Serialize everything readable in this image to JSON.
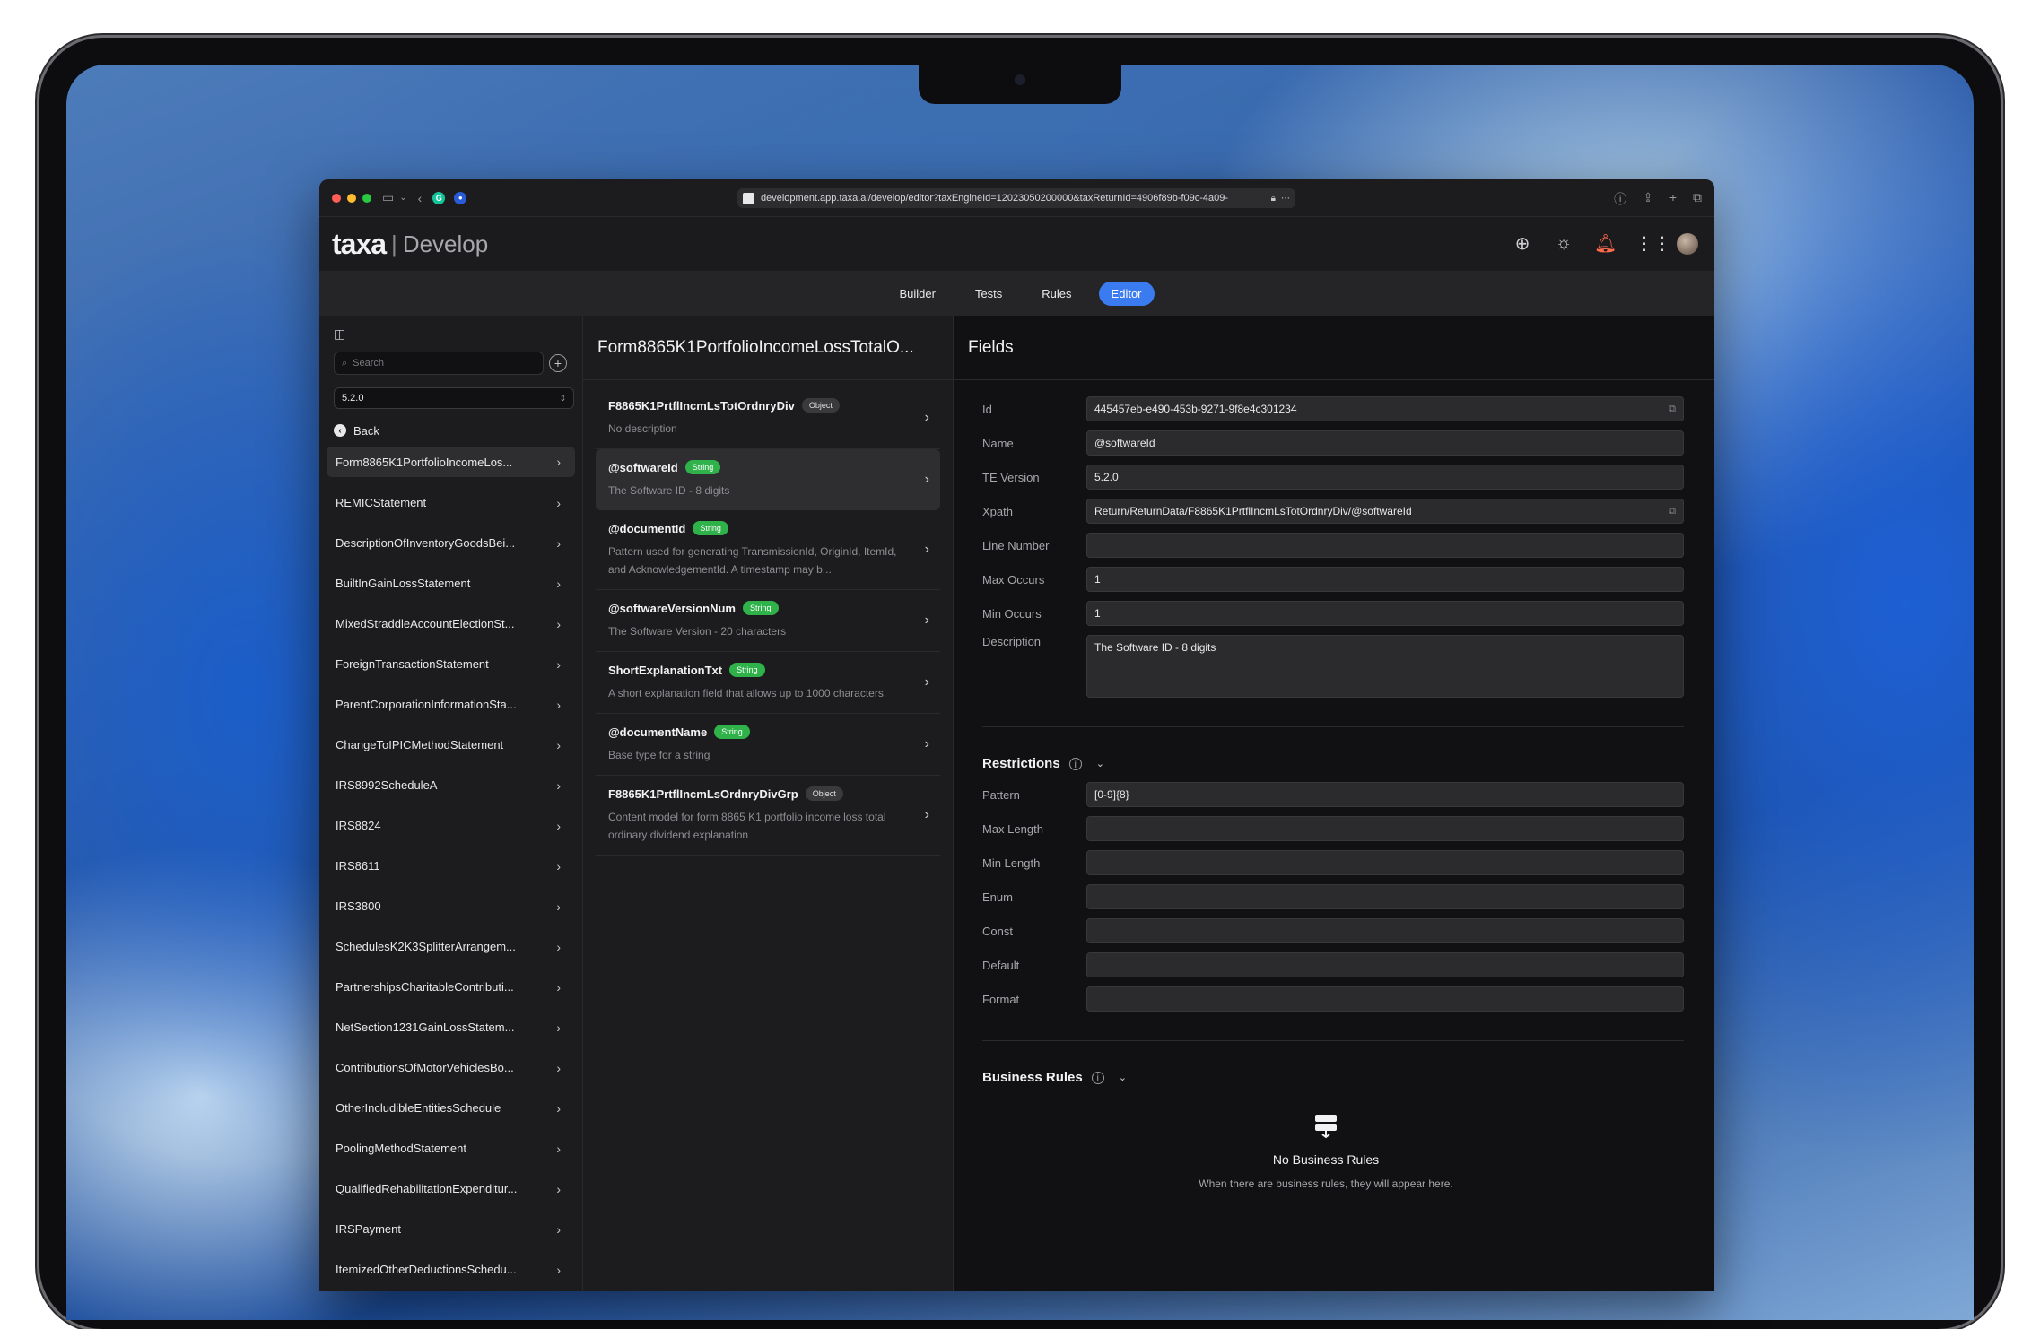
{
  "browser": {
    "url": "development.app.taxa.ai/develop/editor?taxEngineId=12023050200000&taxReturnId=4906f89b-f09c-4a09-"
  },
  "header": {
    "logo": "taxa",
    "product": "Develop"
  },
  "nav": {
    "tabs": [
      {
        "label": "Builder"
      },
      {
        "label": "Tests"
      },
      {
        "label": "Rules"
      },
      {
        "label": "Editor"
      }
    ],
    "active": "Editor"
  },
  "sidebar": {
    "search_placeholder": "Search",
    "version": "5.2.0",
    "back_label": "Back",
    "items": [
      {
        "label": "Form8865K1PortfolioIncomeLos..."
      },
      {
        "label": "REMICStatement"
      },
      {
        "label": "DescriptionOfInventoryGoodsBei..."
      },
      {
        "label": "BuiltInGainLossStatement"
      },
      {
        "label": "MixedStraddleAccountElectionSt..."
      },
      {
        "label": "ForeignTransactionStatement"
      },
      {
        "label": "ParentCorporationInformationSta..."
      },
      {
        "label": "ChangeToIPICMethodStatement"
      },
      {
        "label": "IRS8992ScheduleA"
      },
      {
        "label": "IRS8824"
      },
      {
        "label": "IRS8611"
      },
      {
        "label": "IRS3800"
      },
      {
        "label": "SchedulesK2K3SplitterArrangem..."
      },
      {
        "label": "PartnershipsCharitableContributi..."
      },
      {
        "label": "NetSection1231GainLossStatem..."
      },
      {
        "label": "ContributionsOfMotorVehiclesBo..."
      },
      {
        "label": "OtherIncludibleEntitiesSchedule"
      },
      {
        "label": "PoolingMethodStatement"
      },
      {
        "label": "QualifiedRehabilitationExpenditur..."
      },
      {
        "label": "IRSPayment"
      },
      {
        "label": "ItemizedOtherDeductionsSchedu..."
      }
    ]
  },
  "middle": {
    "title": "Form8865K1PortfolioIncomeLossTotalO...",
    "items": [
      {
        "name": "F8865K1PrtflIncmLsTotOrdnryDiv",
        "type": "Object",
        "desc": "No description"
      },
      {
        "name": "@softwareId",
        "type": "String",
        "desc": "The Software ID - 8 digits"
      },
      {
        "name": "@documentId",
        "type": "String",
        "desc": "Pattern used for generating TransmissionId, OriginId, ItemId, and AcknowledgementId. A timestamp may b..."
      },
      {
        "name": "@softwareVersionNum",
        "type": "String",
        "desc": "The Software Version - 20 characters"
      },
      {
        "name": "ShortExplanationTxt",
        "type": "String",
        "desc": "A short explanation field that allows up to 1000 characters."
      },
      {
        "name": "@documentName",
        "type": "String",
        "desc": "Base type for a string"
      },
      {
        "name": "F8865K1PrtflIncmLsOrdnryDivGrp",
        "type": "Object",
        "desc": "Content model for form 8865 K1 portfolio income loss total ordinary dividend explanation"
      }
    ]
  },
  "fields": {
    "title": "Fields",
    "rows": [
      {
        "label": "Id",
        "value": "445457eb-e490-453b-9271-9f8e4c301234"
      },
      {
        "label": "Name",
        "value": "@softwareId"
      },
      {
        "label": "TE Version",
        "value": "5.2.0"
      },
      {
        "label": "Xpath",
        "value": "Return/ReturnData/F8865K1PrtflIncmLsTotOrdnryDiv/@softwareId"
      },
      {
        "label": "Line Number",
        "value": ""
      },
      {
        "label": "Max Occurs",
        "value": "1"
      },
      {
        "label": "Min Occurs",
        "value": "1"
      }
    ],
    "description_label": "Description",
    "description_value": "The Software ID - 8 digits"
  },
  "restrictions": {
    "title": "Restrictions",
    "rows": [
      {
        "label": "Pattern",
        "value": "[0-9]{8}"
      },
      {
        "label": "Max Length",
        "value": ""
      },
      {
        "label": "Min Length",
        "value": ""
      },
      {
        "label": "Enum",
        "value": ""
      },
      {
        "label": "Const",
        "value": ""
      },
      {
        "label": "Default",
        "value": ""
      },
      {
        "label": "Format",
        "value": ""
      }
    ]
  },
  "business_rules": {
    "title": "Business Rules",
    "empty_title": "No Business Rules",
    "empty_desc": "When there are business rules, they will appear here."
  }
}
